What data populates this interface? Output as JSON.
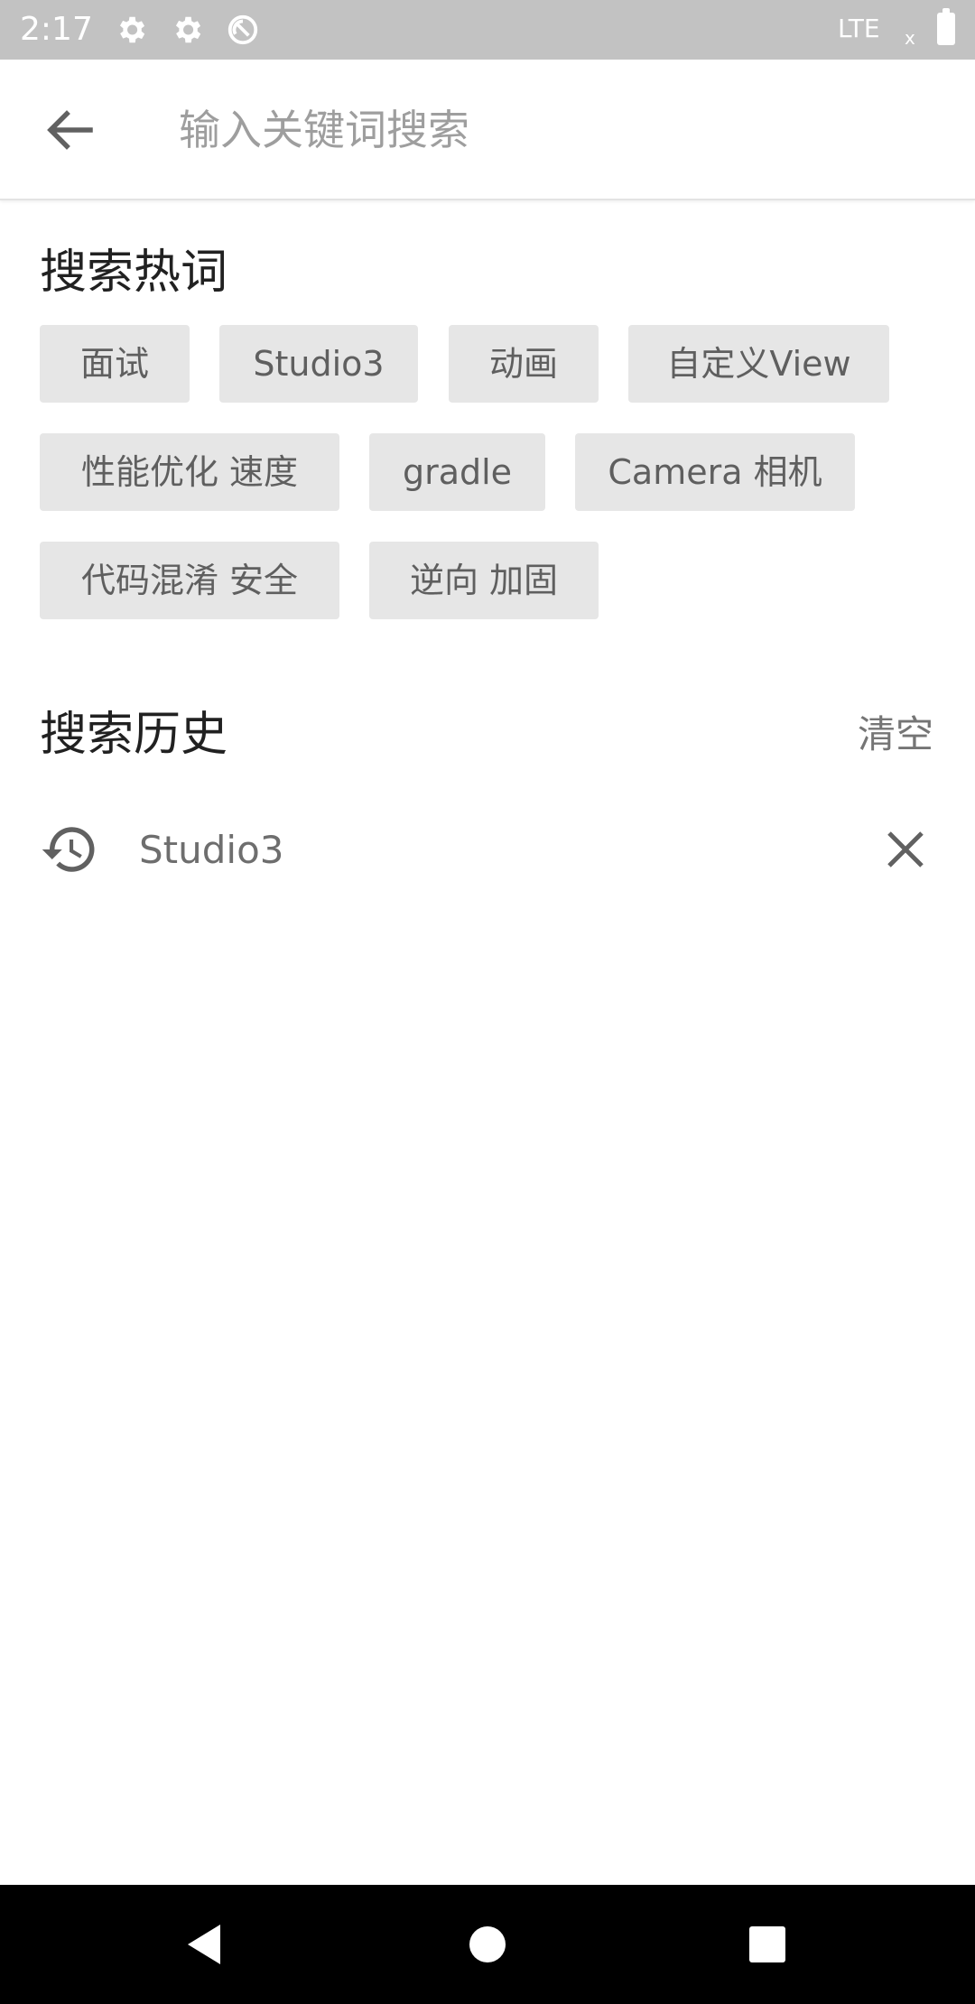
{
  "status_bar": {
    "time": "2:17",
    "network": "LTE",
    "signal_mark": "x",
    "icons": [
      "gear-icon",
      "gear-icon",
      "sync-disabled-icon",
      "battery-icon"
    ],
    "background": "#c2c2c2"
  },
  "search": {
    "placeholder": "输入关键词搜索",
    "value": ""
  },
  "hot": {
    "title": "搜索热词",
    "tags": [
      "面试",
      "Studio3",
      "动画",
      "自定义View",
      "性能优化 速度",
      "gradle",
      "Camera 相机",
      "代码混淆 安全",
      "逆向 加固"
    ]
  },
  "history": {
    "title": "搜索历史",
    "clear_label": "清空",
    "items": [
      "Studio3"
    ]
  },
  "colors": {
    "tag_background": "#e6e6e6",
    "tag_text": "#5f5f5f",
    "nav_background": "#000000"
  }
}
